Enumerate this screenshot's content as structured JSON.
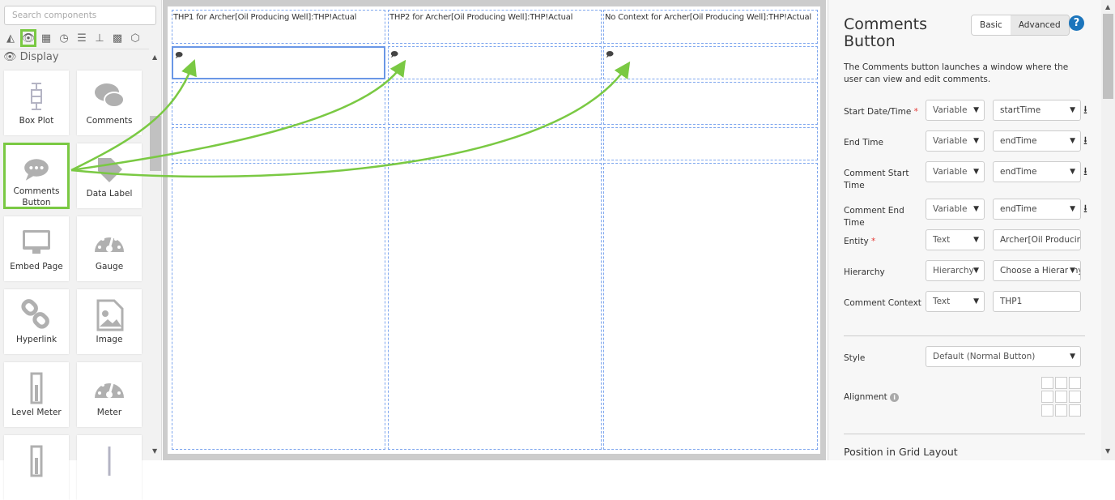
{
  "left_panel": {
    "search_placeholder": "Search components",
    "categories": [
      "area-chart-icon",
      "eye-icon",
      "table-icon",
      "clock-icon",
      "sliders-icon",
      "hierarchy-icon",
      "grid-icon",
      "cube-icon"
    ],
    "section_title": "Display",
    "tiles": [
      {
        "label": "Box Plot",
        "icon": "box-plot-icon"
      },
      {
        "label": "Comments",
        "icon": "comments-icon"
      },
      {
        "label": "Comments Button",
        "icon": "comment-dots-icon",
        "selected": true
      },
      {
        "label": "Data Label",
        "icon": "tag-icon"
      },
      {
        "label": "Embed Page",
        "icon": "monitor-icon"
      },
      {
        "label": "Gauge",
        "icon": "gauge-icon"
      },
      {
        "label": "Hyperlink",
        "icon": "link-icon"
      },
      {
        "label": "Image",
        "icon": "image-icon"
      },
      {
        "label": "Level Meter",
        "icon": "level-meter-icon"
      },
      {
        "label": "Meter",
        "icon": "meter-icon"
      },
      {
        "label": "",
        "icon": "level-meter-icon"
      },
      {
        "label": "",
        "icon": "line-icon"
      }
    ]
  },
  "canvas": {
    "headers": [
      "THP1 for Archer[Oil Producing Well]:THP!Actual",
      "THP2 for Archer[Oil Producing Well]:THP!Actual",
      "No Context for Archer[Oil Producing Well]:THP!Actual"
    ],
    "arrow_color": "#7ac943"
  },
  "right_panel": {
    "title": "Comments Button",
    "mode_basic": "Basic",
    "mode_advanced": "Advanced",
    "help": "?",
    "description": "The Comments button launches a window where the user can view and edit comments.",
    "fields": [
      {
        "label": "Start Date/Time",
        "required": "*",
        "type": "Variable",
        "value": "startTime",
        "pin": true
      },
      {
        "label": "End Time",
        "required": "",
        "type": "Variable",
        "value": "endTime",
        "pin": true
      },
      {
        "label": "Comment Start Time",
        "required": "",
        "type": "Variable",
        "value": "endTime",
        "pin": true
      },
      {
        "label": "Comment End Time",
        "required": "",
        "type": "Variable",
        "value": "endTime",
        "pin": true
      },
      {
        "label": "Entity",
        "required": "*",
        "type": "Text",
        "value": "Archer[Oil Producing Well]",
        "pin": false
      },
      {
        "label": "Hierarchy",
        "required": "",
        "type": "Hierarchy",
        "value": "Choose a Hierarchy",
        "pin": false
      },
      {
        "label": "Comment Context",
        "required": "",
        "type": "Text",
        "value": "THP1",
        "pin": false
      }
    ],
    "style_label": "Style",
    "style_value": "Default (Normal Button)",
    "alignment_label": "Alignment",
    "position_label": "Position in Grid Layout"
  }
}
